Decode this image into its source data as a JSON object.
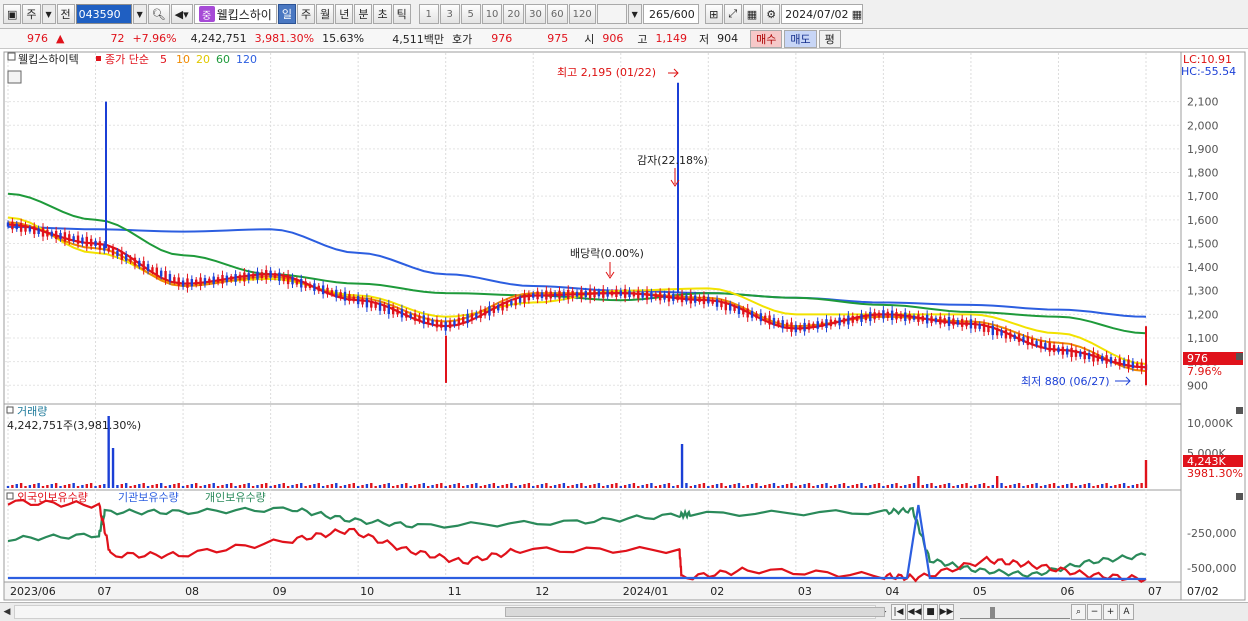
{
  "toolbar": {
    "period_main": "주",
    "prev_label": "전",
    "stock_code": "043590",
    "badge": "중",
    "stock_name": "웰킵스하이",
    "periods": [
      "일",
      "주",
      "월",
      "년",
      "분",
      "초",
      "틱"
    ],
    "active_period": "일",
    "intervals": [
      "1",
      "3",
      "5",
      "10",
      "20",
      "30",
      "60",
      "120"
    ],
    "count": "265",
    "count_total": "/600",
    "date": "2024/07/02"
  },
  "quote": {
    "price": "976",
    "arrow": "▲",
    "change": "72",
    "change_pct": "+7.96%",
    "volume": "4,242,751",
    "vol_pct": "3,981.30%",
    "turnover": "15.63%",
    "amount": "4,511백만",
    "hoga_label": "호가",
    "ask": "976",
    "bid": "975",
    "open_label": "시",
    "open": "906",
    "high_label": "고",
    "high": "1,149",
    "low_label": "저",
    "low": "904",
    "buy_btn": "매수",
    "sell_btn": "매도",
    "flat_btn": "평"
  },
  "price_panel": {
    "stock_label": "웰킵스하이텍",
    "legend_title": "종가 단순",
    "ma_periods": [
      "5",
      "10",
      "20",
      "60",
      "120"
    ],
    "ma_colors": [
      "#e0121b",
      "#f08a00",
      "#f2e200",
      "#1e9a3a",
      "#2c5ee0"
    ],
    "lc_label": "LC:10.91",
    "hc_label": "HC:-55.54",
    "y_ticks": [
      "2,100",
      "2,000",
      "1,900",
      "1,800",
      "1,700",
      "1,600",
      "1,500",
      "1,400",
      "1,300",
      "1,200",
      "1,100",
      "1,000",
      "900"
    ],
    "annotations": {
      "high": "최고 2,195 (01/22)",
      "reduction": "감자(22.18%)",
      "dividend": "배당락(0.00%)",
      "low": "최저 880 (06/27)"
    },
    "current_price_tag": "976",
    "current_pct_tag": "7.96%"
  },
  "volume_panel": {
    "title": "거래량",
    "value": "4,242,751주(3,981.30%)",
    "y_ticks": [
      "10,000K",
      "5,000K"
    ],
    "current_tag": "4,243K",
    "current_pct": "3981.30%"
  },
  "holdings_panel": {
    "legend": [
      "외국인보유수량",
      "기관보유수량",
      "개인보유수량"
    ],
    "colors": [
      "#e0121b",
      "#2c5ee0",
      "#2a8a5a"
    ],
    "y_ticks": [
      "-250,000",
      "-500,000"
    ]
  },
  "x_axis": {
    "labels": [
      "2023/06",
      "07",
      "08",
      "09",
      "10",
      "11",
      "12",
      "2024/01",
      "02",
      "03",
      "04",
      "05",
      "06",
      "07"
    ],
    "right_label": "07/02"
  },
  "chart_data": {
    "type": "line",
    "title": "웰킵스하이텍",
    "x": [
      "2023/06",
      "2023/07",
      "2023/08",
      "2023/09",
      "2023/10",
      "2023/11",
      "2023/12",
      "2024/01",
      "2024/02",
      "2024/03",
      "2024/04",
      "2024/05",
      "2024/06",
      "2024/07"
    ],
    "ylim": [
      880,
      2200
    ],
    "series": [
      {
        "name": "5",
        "values": [
          1580,
          1500,
          1330,
          1370,
          1260,
          1150,
          1280,
          1290,
          1260,
          1140,
          1200,
          1160,
          1050,
          976
        ]
      },
      {
        "name": "10",
        "values": [
          1590,
          1480,
          1320,
          1360,
          1270,
          1170,
          1290,
          1290,
          1270,
          1150,
          1190,
          1170,
          1080,
          960
        ]
      },
      {
        "name": "20",
        "values": [
          1610,
          1460,
          1330,
          1350,
          1280,
          1190,
          1250,
          1300,
          1310,
          1200,
          1200,
          1200,
          1120,
          990
        ]
      },
      {
        "name": "60",
        "values": [
          1710,
          1600,
          1450,
          1370,
          1330,
          1290,
          1280,
          1260,
          1290,
          1270,
          1240,
          1210,
          1190,
          1120
        ]
      },
      {
        "name": "120",
        "values": [
          1570,
          1560,
          1550,
          1560,
          1460,
          1370,
          1320,
          1300,
          1290,
          1270,
          1250,
          1240,
          1220,
          1190
        ]
      }
    ]
  }
}
